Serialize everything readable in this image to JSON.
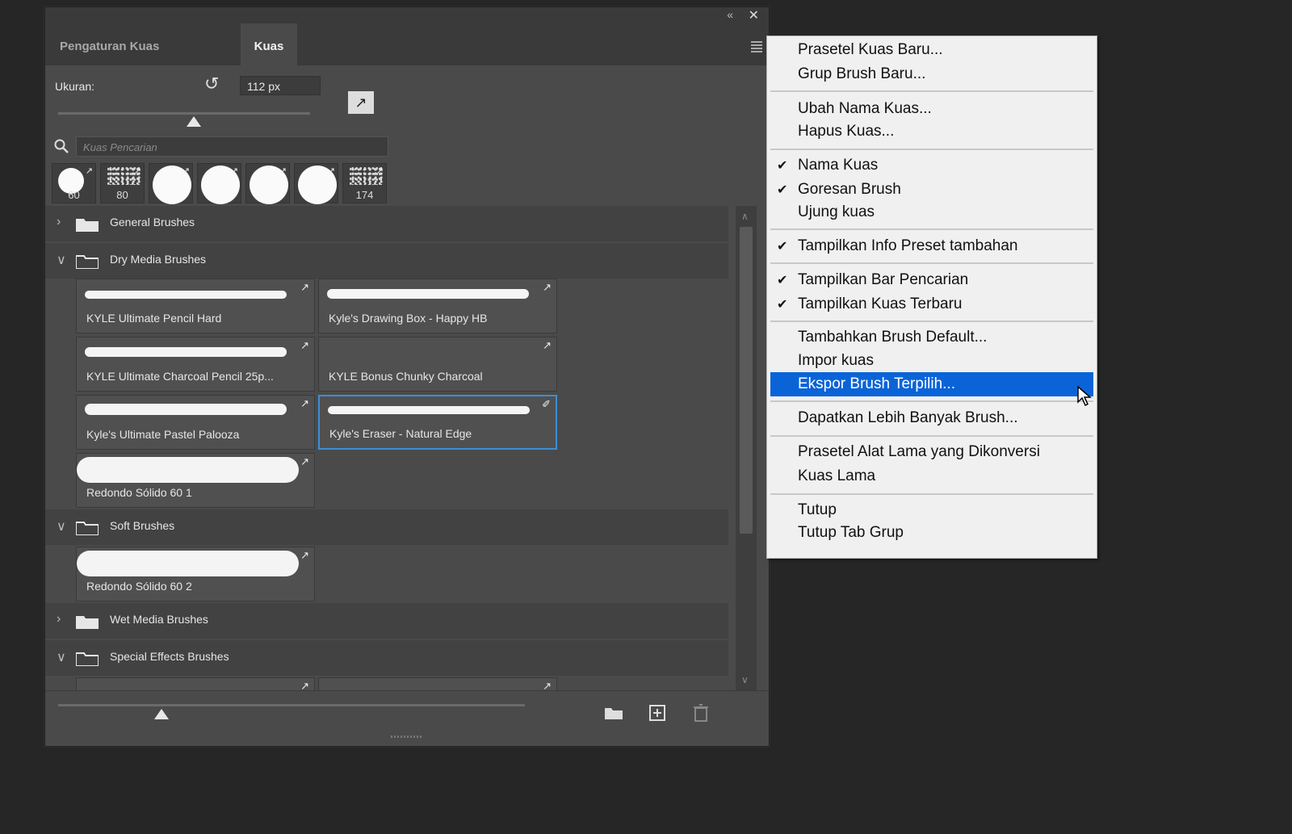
{
  "panel": {
    "tabs": [
      "Pengaturan Kuas",
      "Kuas"
    ],
    "active_tab": "Kuas",
    "collapse_icon": "double-chevron-left",
    "close_icon": "close",
    "size_label": "Ukuran:",
    "size_value": "112 px",
    "search_placeholder": "Kuas Pencarian",
    "recent_brushes": [
      {
        "size": "60",
        "kind": "round-small"
      },
      {
        "size": "80",
        "kind": "texture"
      },
      {
        "size": "",
        "kind": "round"
      },
      {
        "size": "",
        "kind": "round"
      },
      {
        "size": "",
        "kind": "round"
      },
      {
        "size": "",
        "kind": "round"
      },
      {
        "size": "174",
        "kind": "texture"
      }
    ],
    "groups": [
      {
        "name": "General Brushes",
        "expanded": false
      },
      {
        "name": "Dry Media Brushes",
        "expanded": true
      },
      {
        "name": "Soft Brushes",
        "expanded": true
      },
      {
        "name": "Wet Media Brushes",
        "expanded": false
      },
      {
        "name": "Special Effects Brushes",
        "expanded": true
      }
    ],
    "brushes": [
      "KYLE Ultimate Pencil Hard",
      "Kyle's Drawing Box - Happy HB",
      "KYLE Ultimate Charcoal Pencil 25p...",
      "KYLE Bonus Chunky Charcoal",
      "Kyle's Ultimate Pastel Palooza",
      "Kyle's Eraser - Natural Edge",
      "Redondo Sólido 60 1",
      "Redondo Sólido 60 2"
    ],
    "selected_brush": "Kyle's Eraser - Natural Edge",
    "footer_icons": [
      "new-group-folder",
      "new-brush",
      "delete-trash"
    ]
  },
  "menu": {
    "items": [
      {
        "label": "Prasetel Kuas Baru...",
        "checked": false
      },
      {
        "label": "Grup Brush Baru...",
        "checked": false
      },
      {
        "label": "Ubah Nama Kuas...",
        "checked": false
      },
      {
        "label": "Hapus Kuas...",
        "checked": false
      },
      {
        "label": "Nama Kuas",
        "checked": true
      },
      {
        "label": "Goresan Brush",
        "checked": true
      },
      {
        "label": "Ujung kuas",
        "checked": false
      },
      {
        "label": "Tampilkan Info Preset tambahan",
        "checked": true
      },
      {
        "label": "Tampilkan Bar Pencarian",
        "checked": true
      },
      {
        "label": "Tampilkan Kuas Terbaru",
        "checked": true
      },
      {
        "label": "Tambahkan Brush Default...",
        "checked": false
      },
      {
        "label": "Impor kuas",
        "checked": false
      },
      {
        "label": "Ekspor Brush Terpilih...",
        "checked": false
      },
      {
        "label": "Dapatkan Lebih Banyak Brush...",
        "checked": false
      },
      {
        "label": "Prasetel Alat Lama yang Dikonversi",
        "checked": false
      },
      {
        "label": "Kuas Lama",
        "checked": false
      },
      {
        "label": "Tutup",
        "checked": false
      },
      {
        "label": "Tutup Tab Grup",
        "checked": false
      }
    ],
    "highlighted": "Ekspor Brush Terpilih...",
    "highlight_color": "#0a64d8"
  }
}
